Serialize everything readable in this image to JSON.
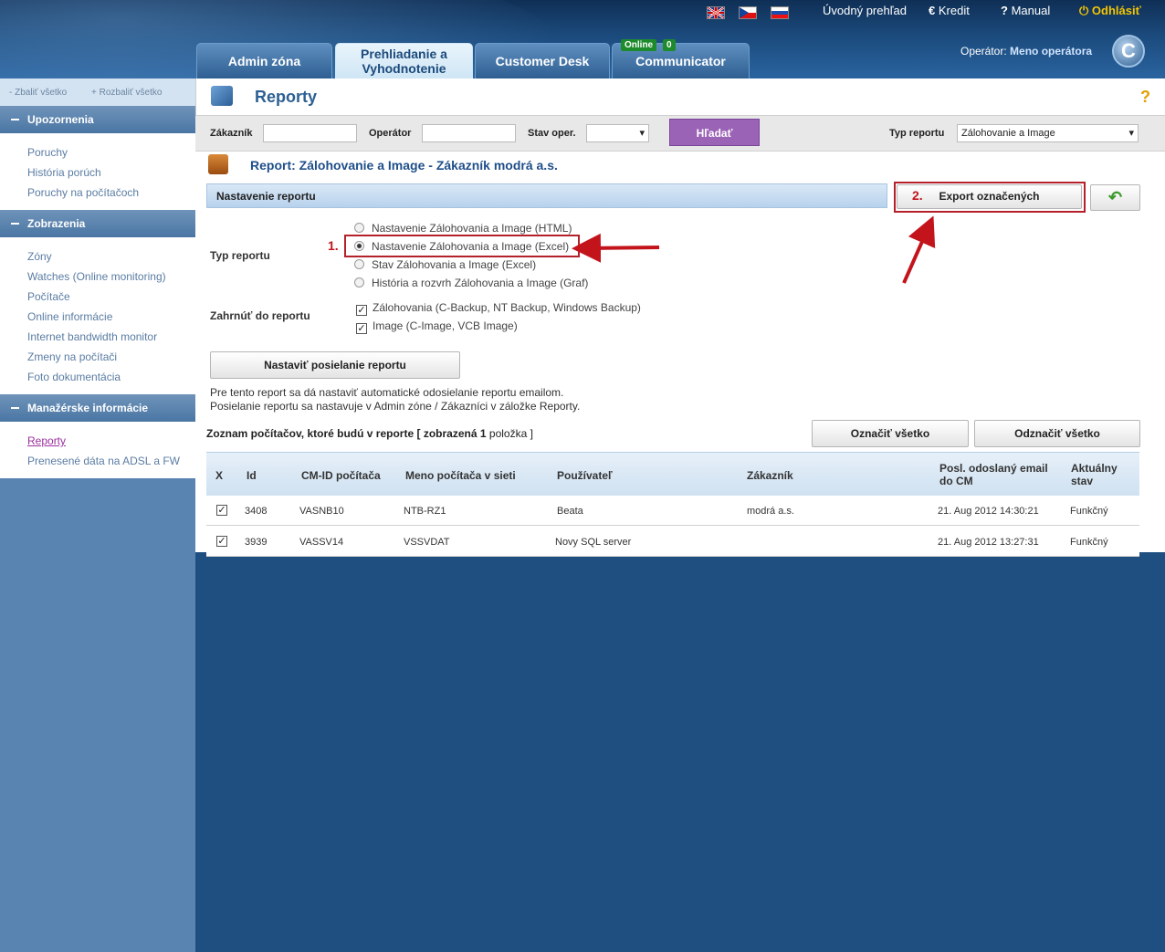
{
  "top": {
    "lang_flags": [
      "en",
      "cz",
      "sk"
    ],
    "links": {
      "overview": "Úvodný prehľad",
      "credit": "Kredit",
      "manual": "Manual",
      "logout": "Odhlásiť"
    }
  },
  "tabs": [
    {
      "label": "Admin zóna"
    },
    {
      "label": "Prehliadanie a Vyhodnotenie"
    },
    {
      "label": "Customer Desk"
    },
    {
      "label": "Communicator"
    }
  ],
  "communicator_badge": {
    "status": "Online",
    "count": "0"
  },
  "operator": {
    "prefix": "Operátor:",
    "name": "Meno operátora"
  },
  "sidebar": {
    "collapse": "Zbaliť všetko",
    "expand": "Rozbaliť všetko",
    "sections": [
      {
        "title": "Upozornenia",
        "items": [
          "Poruchy",
          "História porúch",
          "Poruchy na počítačoch"
        ]
      },
      {
        "title": "Zobrazenia",
        "items": [
          "Zóny",
          "Watches (Online monitoring)",
          "Počítače",
          "Online informácie",
          "Internet bandwidth monitor",
          "Zmeny na počítači",
          "Foto dokumentácia"
        ]
      },
      {
        "title": "Manažérske informácie",
        "items": [
          "Reporty",
          "Prenesené dáta na ADSL a FW"
        ]
      }
    ]
  },
  "page_title": "Reporty",
  "filter": {
    "customer_label": "Zákazník",
    "operator_label": "Operátor",
    "state_label": "Stav oper.",
    "search_button": "Hľadať",
    "type_label": "Typ reportu",
    "type_value": "Zálohovanie a Image"
  },
  "report": {
    "title": "Report: Zálohovanie a Image - Zákazník modrá a.s.",
    "settings_header": "Nastavenie reportu",
    "export_button": "Export označených",
    "step1": "1.",
    "step2": "2.",
    "type_label": "Typ reportu",
    "types": [
      "Nastavenie Zálohovania a Image (HTML)",
      "Nastavenie Zálohovania a Image (Excel)",
      "Stav Zálohovania a Image (Excel)",
      "História a rozvrh Zálohovania a Image (Graf)"
    ],
    "include_label": "Zahrnúť do reportu",
    "includes": [
      "Zálohovania (C-Backup, NT Backup, Windows Backup)",
      "Image (C-Image, VCB Image)"
    ],
    "send_button": "Nastaviť posielanie reportu",
    "info1": "Pre tento report sa dá nastaviť automatické odosielanie reportu emailom.",
    "info2": "Posielanie reportu sa nastavuje v Admin zóne / Zákazníci v záložke Reporty.",
    "list_prefix": "Zoznam počítačov, ktoré budú v reporte",
    "list_shown": "[ zobrazená",
    "list_count": "1",
    "list_suffix": "položka ]",
    "mark_all": "Označiť všetko",
    "unmark_all": "Odznačiť všetko"
  },
  "table": {
    "headers": [
      "X",
      "Id",
      "CM-ID počítača",
      "Meno počítača v sieti",
      "Používateľ",
      "Zákazník",
      "Posl. odoslaný email do CM",
      "Aktuálny stav"
    ],
    "rows": [
      {
        "id": "3408",
        "cmid": "VASNB10",
        "name": "NTB-RZ1",
        "user": "Beata",
        "customer": "modrá a.s.",
        "email": "21. Aug 2012 14:30:21",
        "state": "Funkčný"
      },
      {
        "id": "3939",
        "cmid": "VASSV14",
        "name": "VSSVDAT",
        "user": "Novy SQL server",
        "customer": "",
        "email": "21. Aug 2012 13:27:31",
        "state": "Funkčný"
      }
    ]
  }
}
